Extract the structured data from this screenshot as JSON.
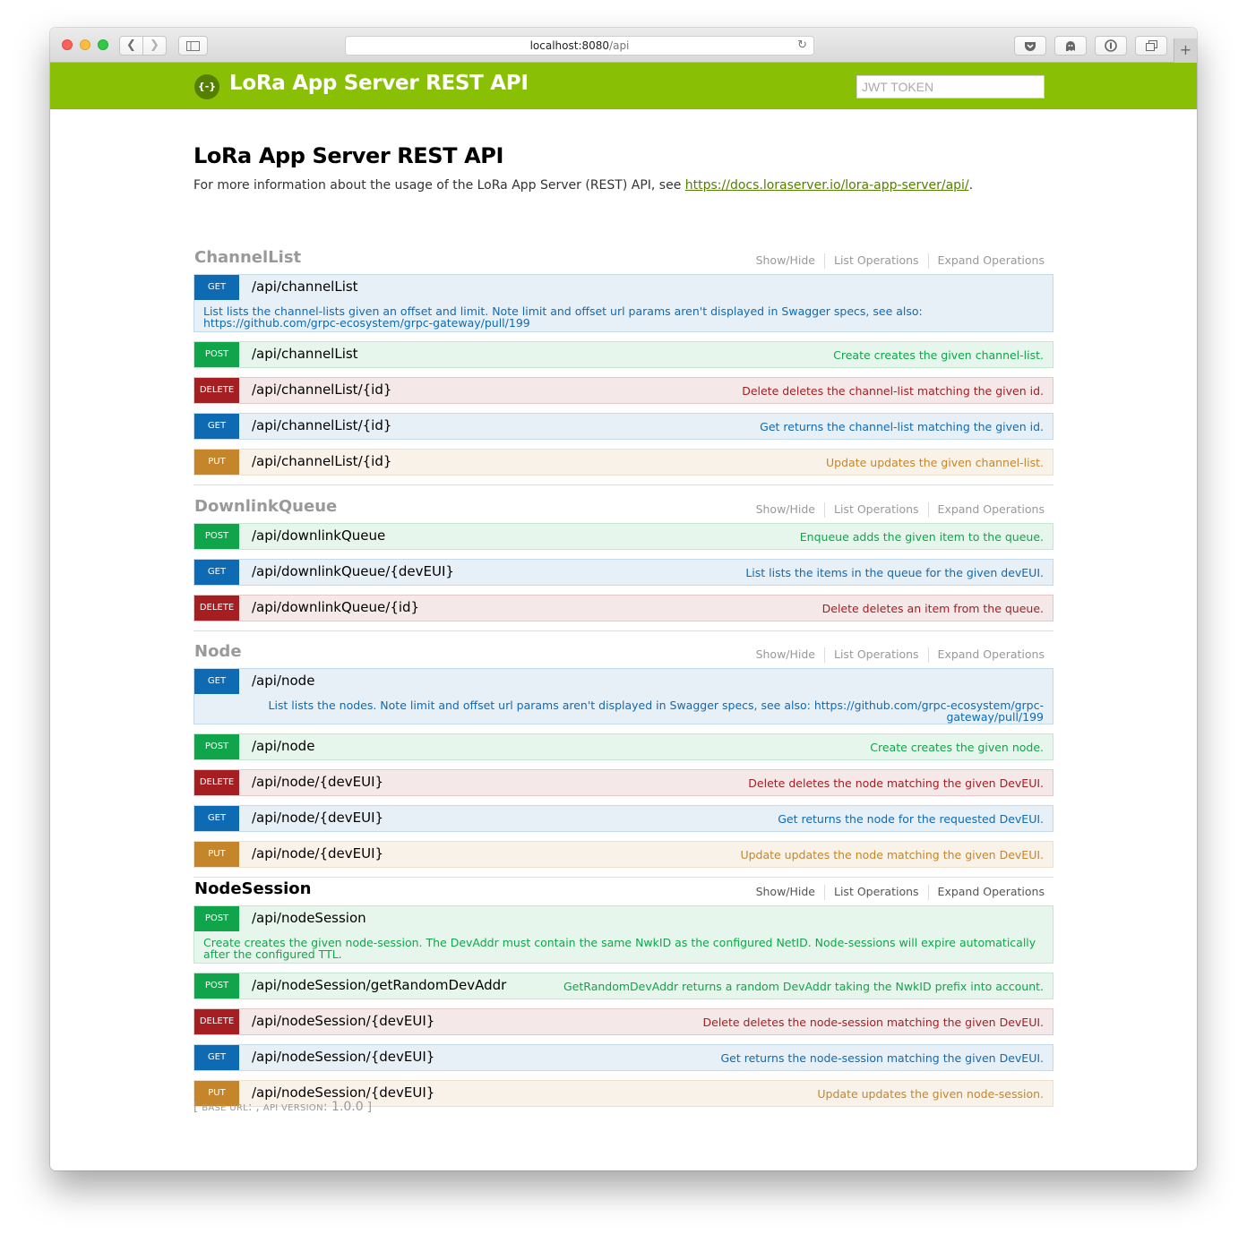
{
  "browser": {
    "url_host": "localhost:8080",
    "url_path": "/api"
  },
  "header": {
    "logo_glyph": "{-}",
    "title": "LoRa App Server REST API",
    "token_placeholder": "JWT TOKEN"
  },
  "info": {
    "title": "LoRa App Server REST API",
    "description_prefix": "For more information about the usage of the LoRa App Server (REST) API, see ",
    "link_text": "https://docs.loraserver.io/lora-app-server/api/",
    "description_suffix": "."
  },
  "resource_links": {
    "show_hide": "Show/Hide",
    "list_operations": "List Operations",
    "expand_operations": "Expand Operations"
  },
  "resources": [
    {
      "name": "ChannelList",
      "operations": [
        {
          "method": "GET",
          "path": "/api/channelList",
          "summary": "",
          "description": "List lists the channel-lists given an offset and limit. Note limit and offset url params aren't displayed in Swagger specs, see also: https://github.com/grpc-ecosystem/grpc-gateway/pull/199"
        },
        {
          "method": "POST",
          "path": "/api/channelList",
          "summary": "Create creates the given channel-list."
        },
        {
          "method": "DELETE",
          "path": "/api/channelList/{id}",
          "summary": "Delete deletes the channel-list matching the given id."
        },
        {
          "method": "GET",
          "path": "/api/channelList/{id}",
          "summary": "Get returns the channel-list matching the given id."
        },
        {
          "method": "PUT",
          "path": "/api/channelList/{id}",
          "summary": "Update updates the given channel-list."
        }
      ]
    },
    {
      "name": "DownlinkQueue",
      "operations": [
        {
          "method": "POST",
          "path": "/api/downlinkQueue",
          "summary": "Enqueue adds the given item to the queue."
        },
        {
          "method": "GET",
          "path": "/api/downlinkQueue/{devEUI}",
          "summary": "List lists the items in the queue for the given devEUI."
        },
        {
          "method": "DELETE",
          "path": "/api/downlinkQueue/{id}",
          "summary": "Delete deletes an item from the queue."
        }
      ]
    },
    {
      "name": "Node",
      "operations": [
        {
          "method": "GET",
          "path": "/api/node",
          "summary": "",
          "description": "List lists the nodes. Note limit and offset url params aren't displayed in Swagger specs, see also: https://github.com/grpc-ecosystem/grpc-gateway/pull/199"
        },
        {
          "method": "POST",
          "path": "/api/node",
          "summary": "Create creates the given node."
        },
        {
          "method": "DELETE",
          "path": "/api/node/{devEUI}",
          "summary": "Delete deletes the node matching the given DevEUI."
        },
        {
          "method": "GET",
          "path": "/api/node/{devEUI}",
          "summary": "Get returns the node for the requested DevEUI."
        },
        {
          "method": "PUT",
          "path": "/api/node/{devEUI}",
          "summary": "Update updates the node matching the given DevEUI."
        }
      ]
    },
    {
      "name": "NodeSession",
      "operations": [
        {
          "method": "POST",
          "path": "/api/nodeSession",
          "summary": "",
          "description": "Create creates the given node-session. The DevAddr must contain the same NwkID as the configured NetID. Node-sessions will expire automatically after the configured TTL."
        },
        {
          "method": "POST",
          "path": "/api/nodeSession/getRandomDevAddr",
          "summary": "GetRandomDevAddr returns a random DevAddr taking the NwkID prefix into account."
        },
        {
          "method": "DELETE",
          "path": "/api/nodeSession/{devEUI}",
          "summary": "Delete deletes the node-session matching the given DevEUI."
        },
        {
          "method": "GET",
          "path": "/api/nodeSession/{devEUI}",
          "summary": "Get returns the node-session matching the given DevEUI."
        },
        {
          "method": "PUT",
          "path": "/api/nodeSession/{devEUI}",
          "summary": "Update updates the given node-session."
        }
      ]
    }
  ],
  "footer": {
    "open_bracket": "[",
    "base_url_label": "base url",
    "base_url_value": ": ,",
    "api_version_label": "api version",
    "api_version_value": ": 1.0.0",
    "close_bracket": "]"
  }
}
